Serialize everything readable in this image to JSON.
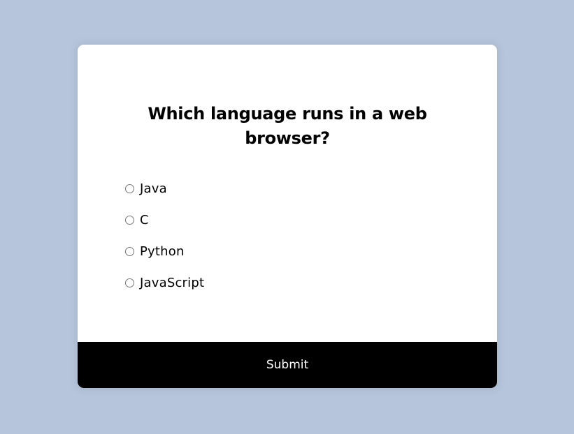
{
  "quiz": {
    "question": "Which language runs in a web browser?",
    "answers": [
      {
        "label": "Java",
        "selected": false
      },
      {
        "label": "C",
        "selected": false
      },
      {
        "label": "Python",
        "selected": false
      },
      {
        "label": "JavaScript",
        "selected": false
      }
    ],
    "submit_label": "Submit"
  },
  "colors": {
    "page_background": "#b6c5db",
    "card_background": "#ffffff",
    "button_background": "#000000",
    "button_text": "#ffffff",
    "text": "#000000"
  }
}
